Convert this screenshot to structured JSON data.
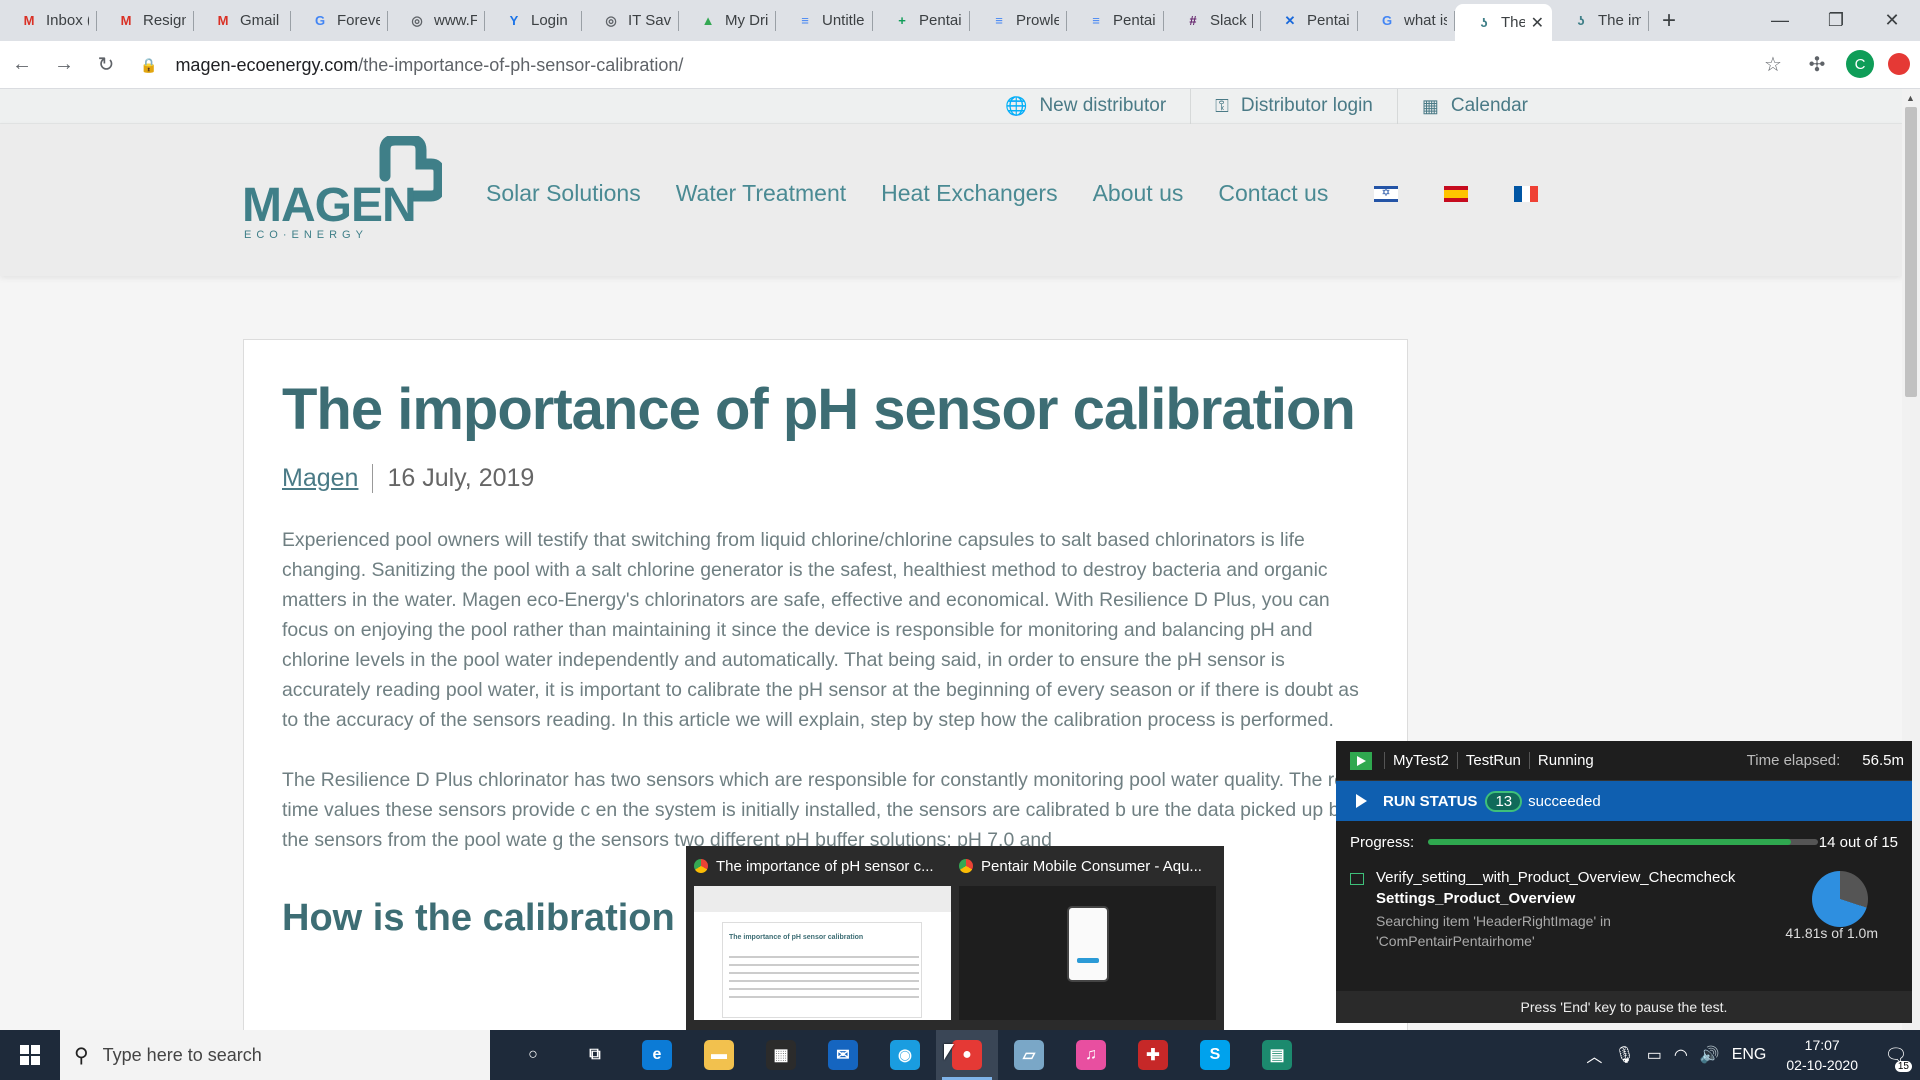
{
  "browser": {
    "tabs": [
      {
        "label": "Inbox (",
        "icon": "gmail-icon",
        "glyph": "M",
        "color": "#d93025"
      },
      {
        "label": "Resign",
        "icon": "gmail-icon",
        "glyph": "M",
        "color": "#d93025"
      },
      {
        "label": "Gmail",
        "icon": "gmail-icon",
        "glyph": "M",
        "color": "#d93025"
      },
      {
        "label": "Foreve",
        "icon": "google-icon",
        "glyph": "G",
        "color": "#4285f4"
      },
      {
        "label": "www.F",
        "icon": "globe-icon",
        "glyph": "◎",
        "color": "#5f6368"
      },
      {
        "label": "Login",
        "icon": "y-icon",
        "glyph": "Y",
        "color": "#1a73e8"
      },
      {
        "label": "IT Savi",
        "icon": "globe-icon",
        "glyph": "◎",
        "color": "#5f6368"
      },
      {
        "label": "My Dri",
        "icon": "drive-icon",
        "glyph": "▲",
        "color": "#34a853"
      },
      {
        "label": "Untitle",
        "icon": "docs-icon",
        "glyph": "≡",
        "color": "#4285f4"
      },
      {
        "label": "Pentai",
        "icon": "sheets-icon",
        "glyph": "+",
        "color": "#0f9d58"
      },
      {
        "label": "Prowle",
        "icon": "docs-icon",
        "glyph": "≡",
        "color": "#4285f4"
      },
      {
        "label": "Pentai",
        "icon": "docs-icon",
        "glyph": "≡",
        "color": "#4285f4"
      },
      {
        "label": "Slack |",
        "icon": "slack-icon",
        "glyph": "#",
        "color": "#611f69"
      },
      {
        "label": "Pentai",
        "icon": "jira-icon",
        "glyph": "✕",
        "color": "#1868db"
      },
      {
        "label": "what is",
        "icon": "google-icon",
        "glyph": "G",
        "color": "#4285f4"
      },
      {
        "label": "The",
        "icon": "magen-icon",
        "glyph": "ʖ",
        "color": "#3f7f88",
        "active": true
      },
      {
        "label": "The im",
        "icon": "magen-icon",
        "glyph": "ʖ",
        "color": "#3f7f88"
      }
    ],
    "url_host": "magen-ecoenergy.com",
    "url_path": "/the-importance-of-ph-sensor-calibration/",
    "profile_initial": "C"
  },
  "site": {
    "topbar": {
      "new_distributor": "New distributor",
      "distributor_login": "Distributor login",
      "calendar": "Calendar"
    },
    "logo": {
      "word": "MAGEN",
      "sub": "ECO·ENERGY"
    },
    "nav": {
      "solar": "Solar Solutions",
      "water": "Water Treatment",
      "heat": "Heat Exchangers",
      "about": "About us",
      "contact": "Contact us"
    }
  },
  "article": {
    "title": "The importance of pH sensor calibration",
    "author": "Magen",
    "date": "16 July, 2019",
    "para1": "Experienced pool owners will testify that switching from liquid chlorine/chlorine capsules to salt based chlorinators is life changing. Sanitizing the pool with a salt chlorine generator is the safest, healthiest method to destroy bacteria and organic matters in the water. Magen eco-Energy's chlorinators are safe, effective and economical. With Resilience D Plus, you can focus on enjoying the pool rather than maintaining it since the device is responsible for monitoring and balancing pH and chlorine levels in the pool water independently and automatically. That being said, in order to ensure the pH sensor is accurately reading pool water, it is important to calibrate the pH sensor at the beginning of every season or if there is doubt as to the accuracy of the sensors reading. In this article we will explain, step by step how the calibration process is performed.",
    "para2": "The Resilience D Plus chlorinator has two sensors which are responsible for constantly monitoring pool water quality. The real time values these sensors provide c                                           en the system is initially installed, the sensors are calibrated b                                          ure the data picked up by the sensors from the pool wate                                            g the sensors two different pH buffer solutions: pH 7.0 and",
    "h2": "How is the calibration pr"
  },
  "thumbnails": [
    {
      "title": "The importance of pH sensor c...",
      "mini_heading": "The importance of pH sensor calibration"
    },
    {
      "title": "Pentair Mobile Consumer - Aqu..."
    }
  ],
  "runstatus": {
    "test": "MyTest2",
    "run": "TestRun",
    "state": "Running",
    "elapsed_label": "Time elapsed:",
    "elapsed": "56.5m",
    "status_label": "RUN STATUS",
    "succeeded_count": "13",
    "succeeded_label": "succeeded",
    "progress_label": "Progress:",
    "progress_fraction": 0.93,
    "progress_text": "14 out of 15",
    "item_line1": "Verify_setting__with_Product_Overview_Checmcheck",
    "item_line2": "Settings_Product_Overview",
    "item_line3": "Searching item 'HeaderRightImage' in 'ComPentairPentairhome'",
    "item_time": "41.81s of 1.0m",
    "item_fraction": 0.7,
    "footer": "Press 'End' key to pause the test."
  },
  "taskbar": {
    "search_placeholder": "Type here to search",
    "apps": [
      {
        "icon": "cortana-icon",
        "glyph": "○",
        "color": "transparent"
      },
      {
        "icon": "task-view-icon",
        "glyph": "⧉",
        "color": "transparent"
      },
      {
        "icon": "edge-icon",
        "glyph": "e",
        "color": "#0c7bd6"
      },
      {
        "icon": "file-explorer-icon",
        "glyph": "▬",
        "color": "#f2c14e"
      },
      {
        "icon": "store-icon",
        "glyph": "▦",
        "color": "#2b2b2b"
      },
      {
        "icon": "mail-icon",
        "glyph": "✉",
        "color": "#1565c0"
      },
      {
        "icon": "browser-blue-icon",
        "glyph": "◉",
        "color": "#1a9de0"
      },
      {
        "icon": "chrome-icon",
        "glyph": "●",
        "color": "#e53935",
        "active": true
      },
      {
        "icon": "notes-icon",
        "glyph": "▱",
        "color": "#7aa7c7"
      },
      {
        "icon": "itunes-icon",
        "glyph": "♫",
        "color": "#e84fa0"
      },
      {
        "icon": "ranorex-icon",
        "glyph": "✚",
        "color": "#c62828"
      },
      {
        "icon": "skype-icon",
        "glyph": "S",
        "color": "#00a2ed"
      },
      {
        "icon": "app-window-icon",
        "glyph": "▤",
        "color": "#1c8a6e"
      }
    ],
    "lang": "ENG",
    "time": "17:07",
    "date": "02-10-2020",
    "notif_count": "15"
  }
}
